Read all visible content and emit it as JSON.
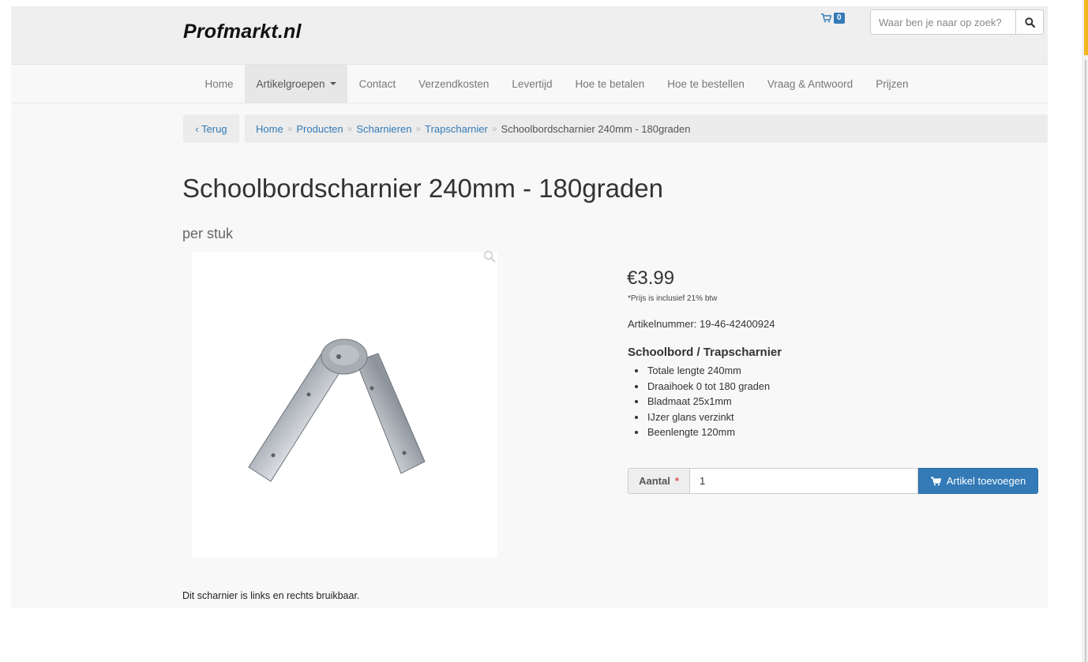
{
  "header": {
    "logo": "Profmarkt.nl",
    "cart_count": "0",
    "search_placeholder": "Waar ben je naar op zoek?"
  },
  "nav": {
    "items": [
      {
        "label": "Home"
      },
      {
        "label": "Artikelgroepen"
      },
      {
        "label": "Contact"
      },
      {
        "label": "Verzendkosten"
      },
      {
        "label": "Levertijd"
      },
      {
        "label": "Hoe te betalen"
      },
      {
        "label": "Hoe te bestellen"
      },
      {
        "label": "Vraag & Antwoord"
      },
      {
        "label": "Prijzen"
      }
    ],
    "active_index": 1
  },
  "breadcrumb": {
    "back_label": "‹ Terug",
    "items": [
      "Home",
      "Producten",
      "Scharnieren",
      "Trapscharnier"
    ],
    "current": "Schoolbordscharnier 240mm - 180graden"
  },
  "product": {
    "title": "Schoolbordscharnier 240mm - 180graden",
    "unit": "per stuk",
    "price": "€3.99",
    "vat_note": "*Prijs is inclusief 21% btw",
    "article_number": "Artikelnummer:  19-46-42400924",
    "desc_title": "Schoolbord / Trapscharnier",
    "bullets": [
      "Totale lengte 240mm",
      "Draaihoek 0 tot 180 graden",
      "Bladmaat 25x1mm",
      "IJzer glans verzinkt",
      "Beenlengte 120mm"
    ],
    "qty_label": "Aantal",
    "qty_required": "*",
    "qty_value": "1",
    "add_button": "Artikel toevoegen",
    "footnote": "Dit scharnier is links en rechts bruikbaar."
  },
  "colors": {
    "accent": "#337ab7",
    "required": "#d9534f",
    "scroll_thumb": "#f3b61f"
  }
}
